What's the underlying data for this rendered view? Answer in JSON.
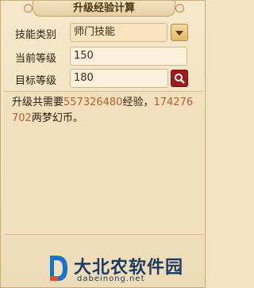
{
  "title": "升级经验计算",
  "skill_type": {
    "label": "技能类别",
    "value": "师门技能"
  },
  "current_level": {
    "label": "当前等级",
    "value": "150"
  },
  "target_level": {
    "label": "目标等级",
    "value": "180"
  },
  "result": {
    "prefix": "升级共需要",
    "exp": "557326480",
    "mid": "经验，",
    "coins": "174276702",
    "suffix": "两梦幻币。"
  },
  "watermark": {
    "name": "大北农软件园",
    "site": "dabeinong.net"
  },
  "colors": {
    "accent_number": "#b4602c",
    "search_button": "#9c1e1a"
  }
}
